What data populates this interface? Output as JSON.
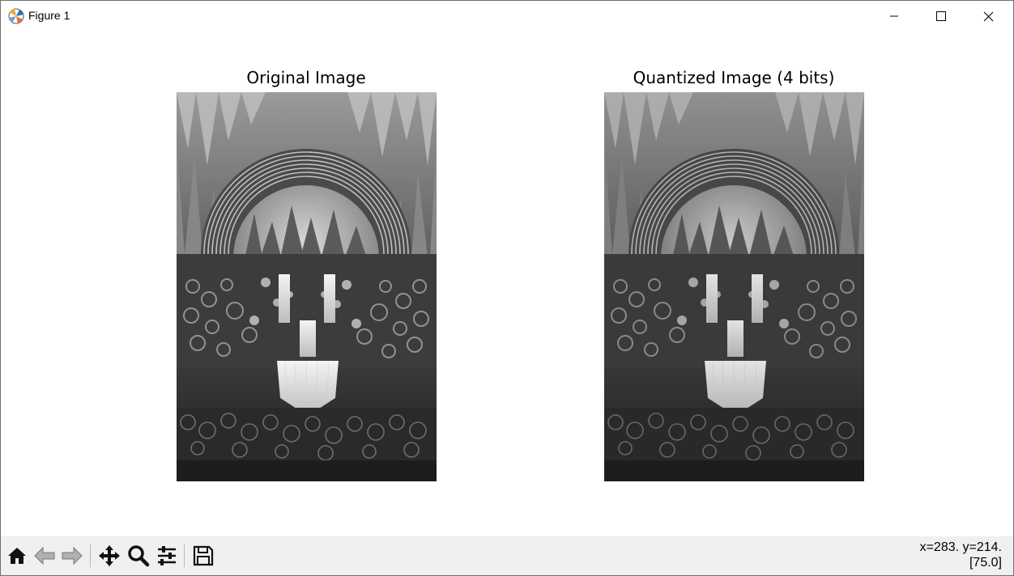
{
  "window": {
    "title": "Figure 1",
    "app_icon": "matplotlib-icon"
  },
  "controls": {
    "minimize_icon": "minimize-icon",
    "maximize_icon": "maximize-icon",
    "close_icon": "close-icon"
  },
  "figure": {
    "left_title": "Original Image",
    "right_title": "Quantized Image (4 bits)",
    "image_subject": "grayscale fantasy waterfall arch with flowers"
  },
  "toolbar": {
    "buttons": [
      "home-icon",
      "back-icon",
      "forward-icon",
      "pan-icon",
      "zoom-icon",
      "configure-subplots-icon",
      "save-icon"
    ],
    "coords_line1": "x=283. y=214.",
    "coords_line2": "[75.0]"
  },
  "colors": {
    "toolbar_bg": "#f0f0f0",
    "canvas_bg": "#ffffff"
  }
}
